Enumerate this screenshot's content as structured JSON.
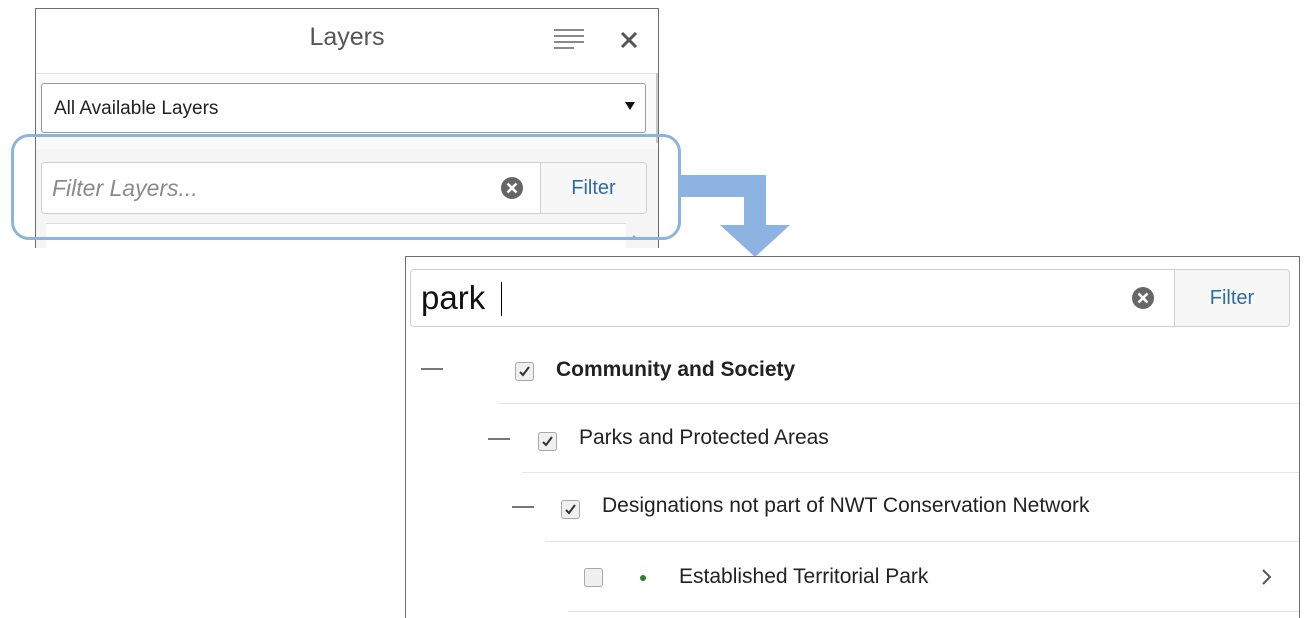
{
  "layers_panel": {
    "title": "Layers",
    "menu_icon": "hamburger-menu-icon",
    "close_icon": "close-icon",
    "layer_select": {
      "selected": "All Available Layers"
    },
    "filter": {
      "placeholder": "Filter Layers...",
      "value": "",
      "clear_icon": "clear-circle-icon",
      "button_label": "Filter"
    }
  },
  "filtered_panel": {
    "filter": {
      "value": "park",
      "clear_icon": "clear-circle-icon",
      "button_label": "Filter"
    },
    "tree": [
      {
        "label": "Community and Society",
        "checked": true,
        "expanded": true,
        "level": 0
      },
      {
        "label": "Parks and Protected Areas",
        "checked": true,
        "expanded": true,
        "level": 1
      },
      {
        "label": "Designations not part of NWT Conservation Network",
        "checked": true,
        "expanded": true,
        "level": 2
      },
      {
        "label": "Established Territorial Park",
        "checked": false,
        "level": 3,
        "status_color": "#2e7d32"
      }
    ]
  },
  "colors": {
    "highlight": "#8db3e2",
    "arrow": "#8db3e2",
    "link_blue": "#2e6da4"
  }
}
